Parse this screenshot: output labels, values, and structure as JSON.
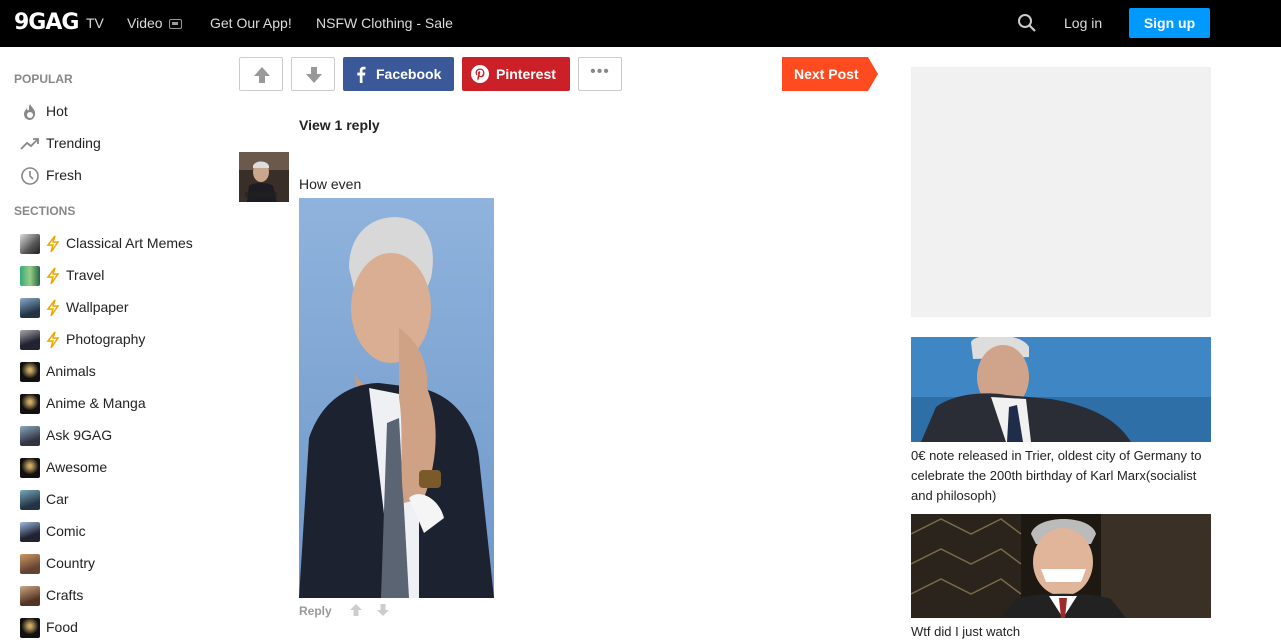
{
  "header": {
    "logo": "9GAG",
    "nav": [
      "TV",
      "Video",
      "Get Our App!",
      "NSFW Clothing - Sale"
    ],
    "login": "Log in",
    "signup": "Sign up"
  },
  "sidebar": {
    "popular_title": "POPULAR",
    "popular": [
      {
        "label": "Hot",
        "icon": "flame-icon"
      },
      {
        "label": "Trending",
        "icon": "trending-icon"
      },
      {
        "label": "Fresh",
        "icon": "clock-icon"
      }
    ],
    "sections_title": "SECTIONS",
    "sections": [
      {
        "label": "Classical Art Memes",
        "featured": true
      },
      {
        "label": "Travel",
        "featured": true
      },
      {
        "label": "Wallpaper",
        "featured": true
      },
      {
        "label": "Photography",
        "featured": true
      },
      {
        "label": "Animals",
        "featured": false
      },
      {
        "label": "Anime & Manga",
        "featured": false
      },
      {
        "label": "Ask 9GAG",
        "featured": false
      },
      {
        "label": "Awesome",
        "featured": false
      },
      {
        "label": "Car",
        "featured": false
      },
      {
        "label": "Comic",
        "featured": false
      },
      {
        "label": "Country",
        "featured": false
      },
      {
        "label": "Crafts",
        "featured": false
      },
      {
        "label": "Food",
        "featured": false
      }
    ]
  },
  "actions": {
    "facebook": "Facebook",
    "pinterest": "Pinterest",
    "next_post": "Next Post"
  },
  "comments": {
    "view_reply": "View 1 reply",
    "text": "How even",
    "reply": "Reply"
  },
  "right": {
    "featured": [
      {
        "title": "0€ note released in Trier, oldest city of Germany to celebrate the 200th birthday of Karl Marx(socialist and philosoph)"
      },
      {
        "title": "Wtf did I just watch"
      }
    ]
  },
  "colors": {
    "header_bg": "#000000",
    "signup": "#0099ff",
    "facebook": "#3b5998",
    "pinterest": "#cb2027",
    "next_post": "#ff4b1f"
  }
}
